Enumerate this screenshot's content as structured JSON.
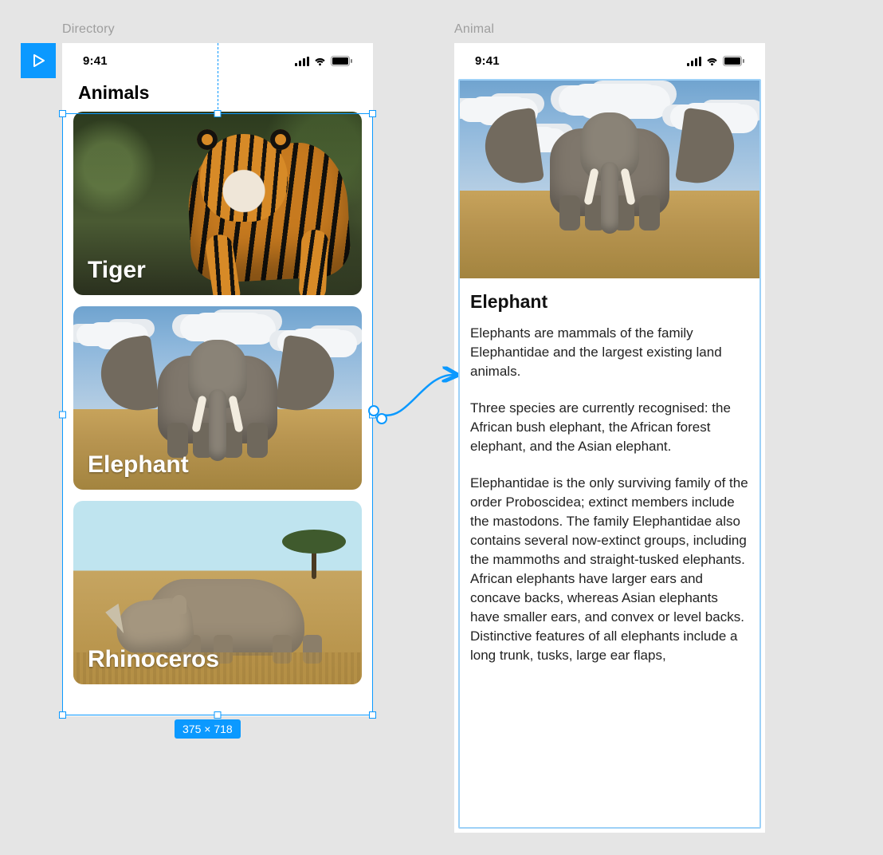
{
  "canvas": {
    "frame_labels": {
      "directory": "Directory",
      "animal": "Animal"
    },
    "selection_size_label": "375 × 718",
    "accent_color": "#0b99ff"
  },
  "status_bar": {
    "time": "9:41"
  },
  "directory_screen": {
    "title": "Animals",
    "cards": [
      {
        "label": "Tiger",
        "kind": "tiger"
      },
      {
        "label": "Elephant",
        "kind": "elephant"
      },
      {
        "label": "Rhinoceros",
        "kind": "rhino"
      }
    ]
  },
  "animal_screen": {
    "title": "Elephant",
    "paragraphs": [
      "Elephants are mammals of the family Elephantidae and the largest existing land animals.",
      "Three species are currently recognised: the African bush elephant, the African forest elephant, and the Asian elephant.",
      "Elephantidae is the only surviving family of the order Proboscidea; extinct members include the mastodons. The family Elephantidae also contains several now-extinct groups, including the mammoths and straight-tusked elephants. African elephants have larger ears and concave backs, whereas Asian elephants have smaller ears, and convex or level backs. Distinctive features of all elephants include a long trunk, tusks, large ear flaps,"
    ]
  }
}
